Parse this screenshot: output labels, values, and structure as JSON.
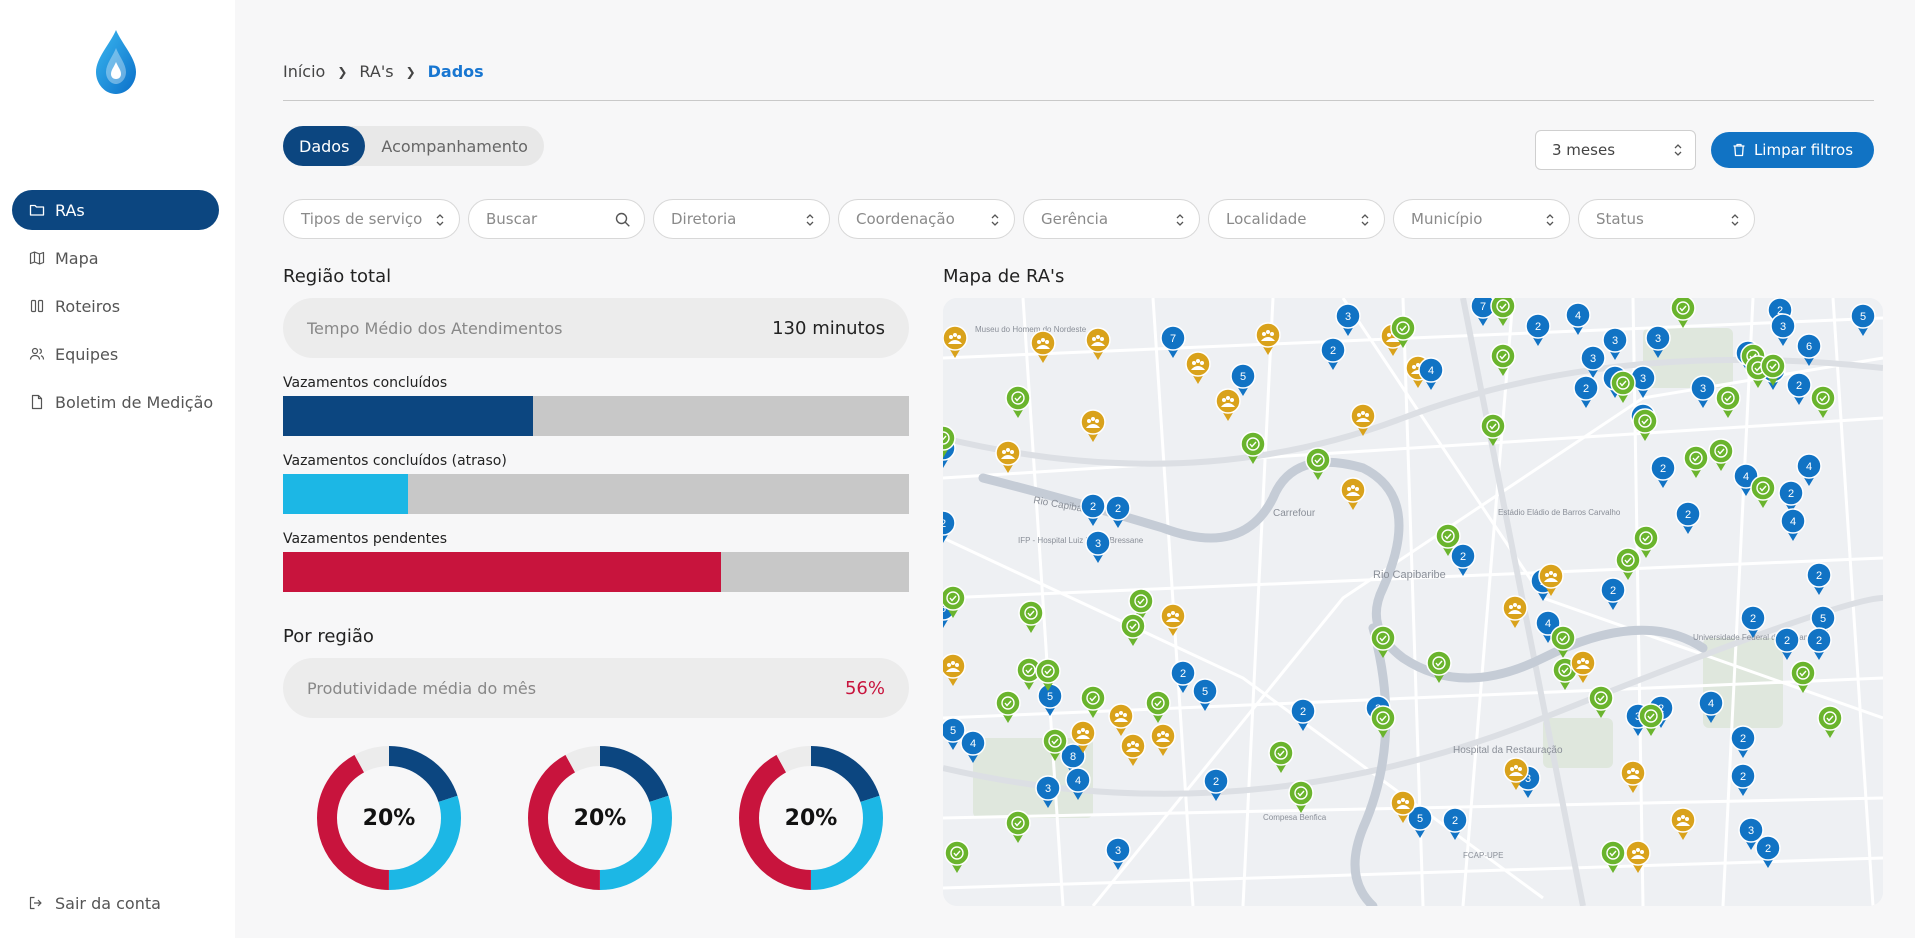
{
  "sidebar": {
    "items": [
      {
        "label": "RAs",
        "icon": "folder-icon",
        "active": true
      },
      {
        "label": "Mapa",
        "icon": "map-icon",
        "active": false
      },
      {
        "label": "Roteiros",
        "icon": "columns-icon",
        "active": false
      },
      {
        "label": "Equipes",
        "icon": "users-icon",
        "active": false
      },
      {
        "label": "Boletim de Medição",
        "icon": "file-icon",
        "active": false
      }
    ],
    "logout_label": "Sair da conta"
  },
  "breadcrumb": [
    "Início",
    "RA's",
    "Dados"
  ],
  "tabs": [
    {
      "label": "Dados",
      "active": true
    },
    {
      "label": "Acompanhamento",
      "active": false
    }
  ],
  "period_select": {
    "value": "3 meses"
  },
  "clear_filters_label": "Limpar filtros",
  "filters": [
    {
      "label": "Tipos de serviço",
      "kind": "select"
    },
    {
      "label": "Buscar",
      "kind": "search"
    },
    {
      "label": "Diretoria",
      "kind": "select"
    },
    {
      "label": "Coordenação",
      "kind": "select"
    },
    {
      "label": "Gerência",
      "kind": "select"
    },
    {
      "label": "Localidade",
      "kind": "select"
    },
    {
      "label": "Município",
      "kind": "select"
    },
    {
      "label": "Status",
      "kind": "select"
    }
  ],
  "regiao_total": {
    "title": "Região total",
    "avg_time_label": "Tempo Médio dos Atendimentos",
    "avg_time_value": "130 minutos",
    "bars": [
      {
        "label": "Vazamentos concluídos",
        "fraction": 0.4,
        "color": "#0c4680"
      },
      {
        "label": "Vazamentos concluídos (atraso)",
        "fraction": 0.2,
        "color": "#1cb7e5"
      },
      {
        "label": "Vazamentos pendentes",
        "fraction": 0.7,
        "color": "#c8143d"
      }
    ]
  },
  "por_regiao": {
    "title": "Por região",
    "productivity_label": "Produtividade média do mês",
    "productivity_value": "56%",
    "donuts": [
      {
        "label": "20%",
        "segments": [
          {
            "color": "#0c4680",
            "frac": 0.2
          },
          {
            "color": "#1cb7e5",
            "frac": 0.3
          },
          {
            "color": "#c8143d",
            "frac": 0.42
          },
          {
            "color": "#ececec",
            "frac": 0.08
          }
        ]
      },
      {
        "label": "20%",
        "segments": [
          {
            "color": "#0c4680",
            "frac": 0.2
          },
          {
            "color": "#1cb7e5",
            "frac": 0.3
          },
          {
            "color": "#c8143d",
            "frac": 0.42
          },
          {
            "color": "#ececec",
            "frac": 0.08
          }
        ]
      },
      {
        "label": "20%",
        "segments": [
          {
            "color": "#0c4680",
            "frac": 0.2
          },
          {
            "color": "#1cb7e5",
            "frac": 0.3
          },
          {
            "color": "#c8143d",
            "frac": 0.42
          },
          {
            "color": "#ececec",
            "frac": 0.08
          }
        ]
      }
    ]
  },
  "map": {
    "title": "Mapa de RA's",
    "place_labels": [
      "Rio Capibaribe",
      "Rio Capibaribe",
      "Carrefour",
      "Hospital da Restauração",
      "Universidade Federal de Pernambuco",
      "Estádio Eládio de Barros Carvalho",
      "Museu do Homem do Nordeste",
      "Compesa Benfica",
      "FCAP-UPE",
      "IFP - Hospital Luiz Felipe Bressane"
    ],
    "colors": {
      "blue": "#1173c4",
      "green": "#6ab42d",
      "gold": "#d9a21b"
    }
  }
}
